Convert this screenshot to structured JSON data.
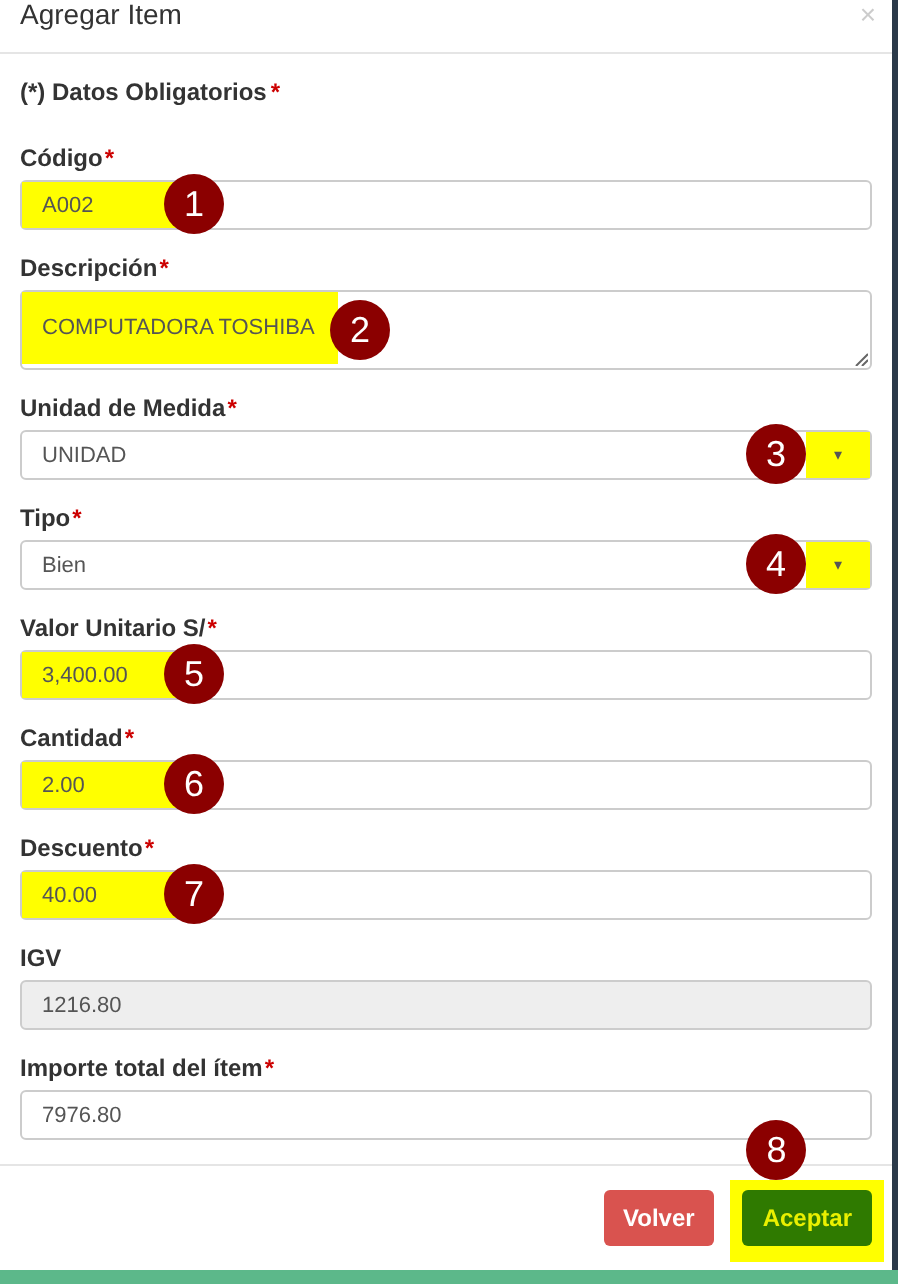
{
  "window": {
    "title": "Agregar Item",
    "close": "×"
  },
  "note": {
    "text": "(*) Datos Obligatorios",
    "required": "*"
  },
  "fields": [
    {
      "kind": "text",
      "label": "Código",
      "required": "*",
      "value": "A002",
      "highlight": true,
      "marker": "1"
    },
    {
      "kind": "textarea",
      "label": "Descripción",
      "required": "*",
      "value": "COMPUTADORA TOSHIBA",
      "highlight": true,
      "marker": "2"
    },
    {
      "kind": "select",
      "label": "Unidad de Medida",
      "required": "*",
      "value": "UNIDAD",
      "arrow": "▾",
      "highlight": true,
      "marker": "3"
    },
    {
      "kind": "select",
      "label": "Tipo",
      "required": "*",
      "value": "Bien",
      "arrow": "▾",
      "highlight": true,
      "marker": "4"
    },
    {
      "kind": "text",
      "label": "Valor Unitario S/",
      "required": "*",
      "value": "3,400.00",
      "highlight": true,
      "marker": "5"
    },
    {
      "kind": "text",
      "label": "Cantidad",
      "required": "*",
      "value": "2.00",
      "highlight": true,
      "marker": "6"
    },
    {
      "kind": "text",
      "label": "Descuento",
      "required": "*",
      "value": "40.00",
      "highlight": true,
      "marker": "7"
    },
    {
      "kind": "disabled",
      "label": "IGV",
      "value": "1216.80",
      "highlight": false
    },
    {
      "kind": "text",
      "label": "Importe total del ítem",
      "required": "*",
      "value": "7976.80",
      "highlight": false
    }
  ],
  "buttons": [
    {
      "kind": "danger",
      "label": "Volver",
      "highlight": false
    },
    {
      "kind": "success",
      "label": "Aceptar",
      "highlight": true,
      "marker": "8"
    }
  ]
}
